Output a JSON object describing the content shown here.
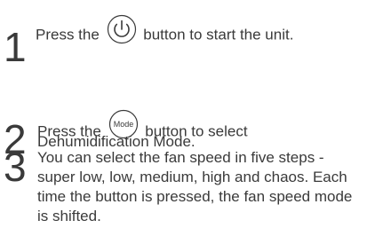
{
  "steps": [
    {
      "number": "1",
      "before": "Press the",
      "icon": "power-icon",
      "after": "button to start the unit."
    },
    {
      "number": "2",
      "before": "Press the",
      "icon": "mode-button-icon",
      "icon_text": "Mode",
      "after": "button to select",
      "line2": "Dehumidification Mode."
    },
    {
      "number": "3",
      "lines": [
        "You can select the fan speed in five steps -",
        "super low, low, medium, high and chaos. Each",
        "time the button is pressed, the fan speed mode",
        "is shifted."
      ]
    }
  ]
}
